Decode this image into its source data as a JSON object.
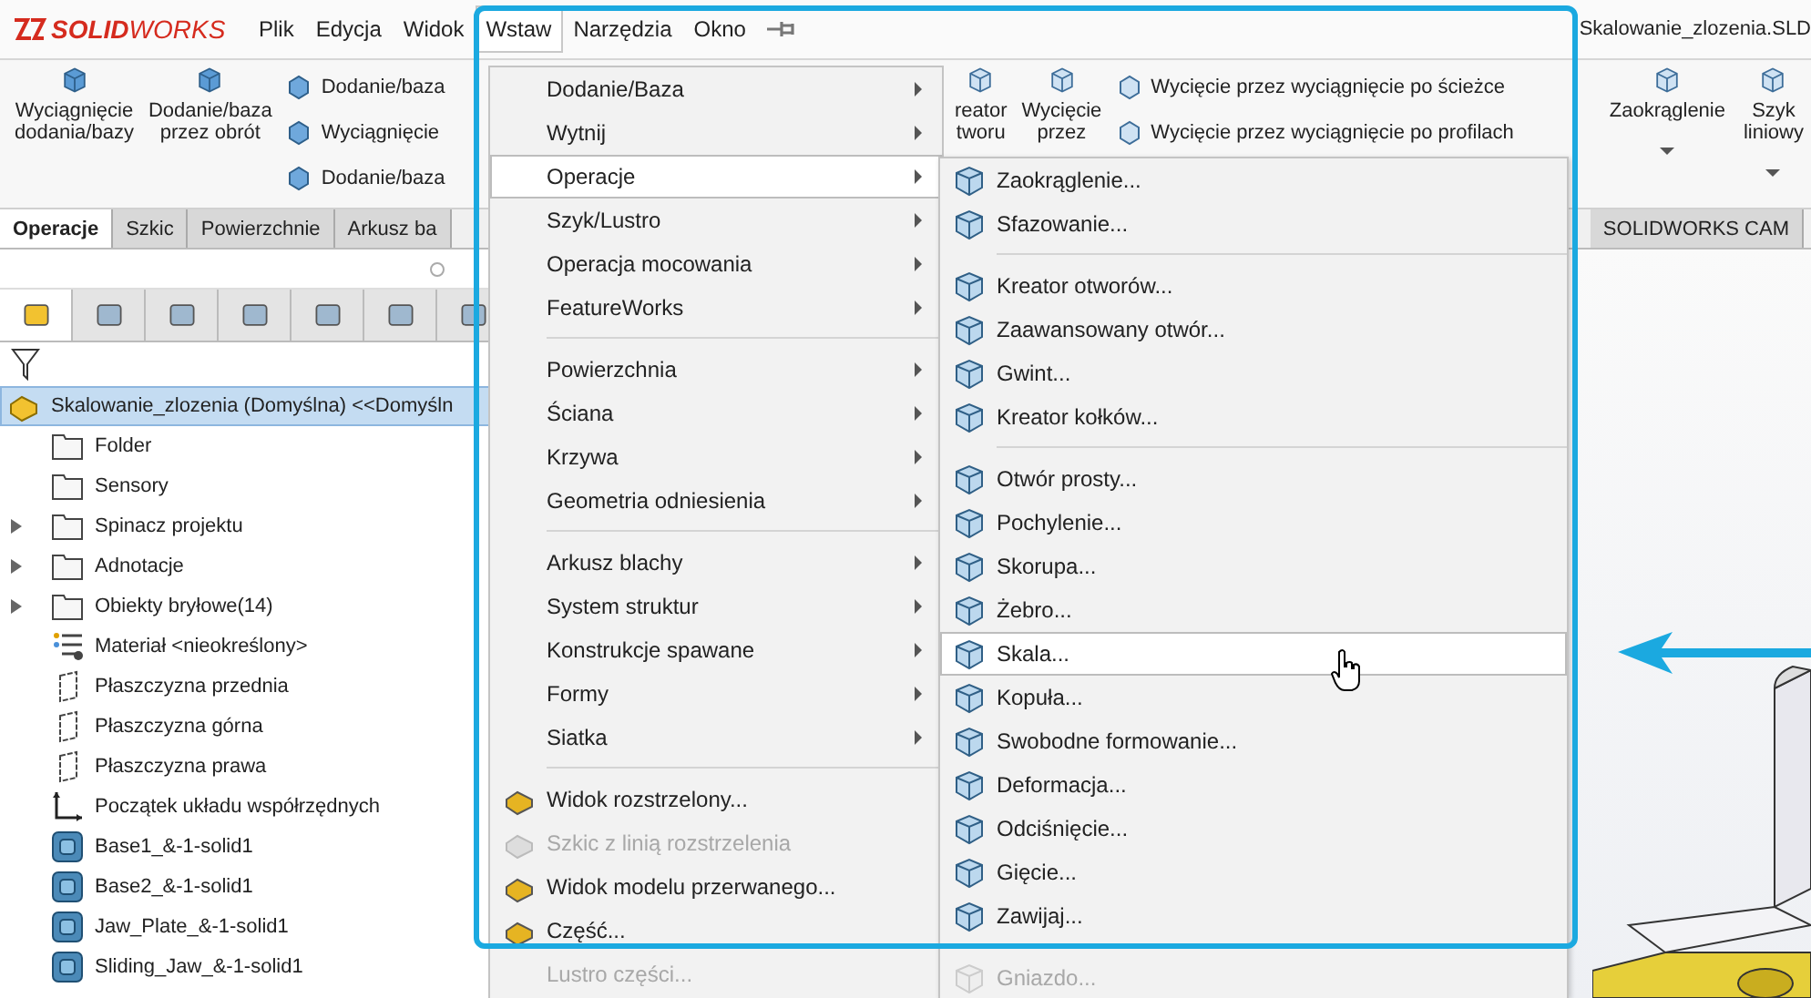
{
  "app": {
    "logo_bold": "SOLID",
    "logo_light": "WORKS",
    "document_title": "Skalowanie_zlozenia.SLD"
  },
  "menu_bar": [
    {
      "label": "Plik",
      "selected": false
    },
    {
      "label": "Edycja",
      "selected": false
    },
    {
      "label": "Widok",
      "selected": false
    },
    {
      "label": "Wstaw",
      "selected": true
    },
    {
      "label": "Narzędzia",
      "selected": false
    },
    {
      "label": "Okno",
      "selected": false
    }
  ],
  "ribbon_left": [
    {
      "kind": "large",
      "lines": [
        "Wyciągnięcie",
        "dodania/bazy"
      ]
    },
    {
      "kind": "large",
      "lines": [
        "Dodanie/baza",
        "przez obrót"
      ]
    },
    {
      "kind": "stack",
      "items": [
        "Dodanie/baza",
        "Wyciągnięcie",
        "Dodanie/baza"
      ]
    }
  ],
  "ribbon_right": [
    {
      "kind": "large",
      "lines": [
        "reator",
        "tworu"
      ]
    },
    {
      "kind": "large",
      "lines": [
        "Wycięcie",
        "przez"
      ]
    },
    {
      "kind": "stack",
      "items": [
        "Wycięcie przez wyciągnięcie po ścieżce",
        "Wycięcie przez wyciągnięcie po profilach"
      ]
    },
    {
      "kind": "caret",
      "lines": [
        "Zaokrąglenie"
      ]
    },
    {
      "kind": "caret",
      "lines": [
        "Szyk",
        "liniowy"
      ]
    }
  ],
  "ribbon_tabs": [
    {
      "label": "Operacje",
      "selected": true
    },
    {
      "label": "Szkic",
      "selected": false
    },
    {
      "label": "Powierzchnie",
      "selected": false
    },
    {
      "label": "Arkusz ba",
      "selected": false
    }
  ],
  "ribbon_tabs_right": [
    {
      "label": "SOLIDWORKS CAM",
      "selected": false
    }
  ],
  "panel_tabs": [
    {
      "selected": true
    },
    {
      "selected": false
    },
    {
      "selected": false
    },
    {
      "selected": false
    },
    {
      "selected": false
    },
    {
      "selected": false
    },
    {
      "selected": false
    }
  ],
  "tree": {
    "root": {
      "label": "Skalowanie_zlozenia (Domyślna) <<Domyśln",
      "selected": true
    },
    "items": [
      {
        "label": "Folder",
        "kind": "folder",
        "expandable": false
      },
      {
        "label": "Sensory",
        "kind": "folder",
        "expandable": false
      },
      {
        "label": "Spinacz projektu",
        "kind": "folder",
        "expandable": true
      },
      {
        "label": "Adnotacje",
        "kind": "folder",
        "expandable": true
      },
      {
        "label": "Obiekty bryłowe(14)",
        "kind": "folder",
        "expandable": true
      },
      {
        "label": "Materiał <nieokreślony>",
        "kind": "material",
        "expandable": false
      },
      {
        "label": "Płaszczyzna przednia",
        "kind": "plane",
        "expandable": false
      },
      {
        "label": "Płaszczyzna górna",
        "kind": "plane",
        "expandable": false
      },
      {
        "label": "Płaszczyzna prawa",
        "kind": "plane",
        "expandable": false
      },
      {
        "label": "Początek układu współrzędnych",
        "kind": "origin",
        "expandable": false
      },
      {
        "label": "Base1_&-1-solid1",
        "kind": "solid",
        "expandable": false
      },
      {
        "label": "Base2_&-1-solid1",
        "kind": "solid",
        "expandable": false
      },
      {
        "label": "Jaw_Plate_&-1-solid1",
        "kind": "solid",
        "expandable": false
      },
      {
        "label": "Sliding_Jaw_&-1-solid1",
        "kind": "solid",
        "expandable": false
      }
    ]
  },
  "insert_menu": {
    "groups": [
      [
        {
          "label": "Dodanie/Baza",
          "kind": "submenu",
          "selected": false,
          "disabled": false
        },
        {
          "label": "Wytnij",
          "kind": "submenu",
          "selected": false,
          "disabled": false
        },
        {
          "label": "Operacje",
          "kind": "submenu",
          "selected": true,
          "disabled": false
        },
        {
          "label": "Szyk/Lustro",
          "kind": "submenu",
          "selected": false,
          "disabled": false
        },
        {
          "label": "Operacja mocowania",
          "kind": "submenu",
          "selected": false,
          "disabled": false
        },
        {
          "label": "FeatureWorks",
          "kind": "submenu",
          "selected": false,
          "disabled": false
        }
      ],
      [
        {
          "label": "Powierzchnia",
          "kind": "submenu",
          "selected": false,
          "disabled": false
        },
        {
          "label": "Ściana",
          "kind": "submenu",
          "selected": false,
          "disabled": false
        },
        {
          "label": "Krzywa",
          "kind": "submenu",
          "selected": false,
          "disabled": false
        },
        {
          "label": "Geometria odniesienia",
          "kind": "submenu",
          "selected": false,
          "disabled": false
        }
      ],
      [
        {
          "label": "Arkusz blachy",
          "kind": "submenu",
          "selected": false,
          "disabled": false
        },
        {
          "label": "System struktur",
          "kind": "submenu",
          "selected": false,
          "disabled": false
        },
        {
          "label": "Konstrukcje spawane",
          "kind": "submenu",
          "selected": false,
          "disabled": false
        },
        {
          "label": "Formy",
          "kind": "submenu",
          "selected": false,
          "disabled": false
        },
        {
          "label": "Siatka",
          "kind": "submenu",
          "selected": false,
          "disabled": false
        }
      ],
      [
        {
          "label": "Widok rozstrzelony...",
          "kind": "command",
          "selected": false,
          "disabled": false
        },
        {
          "label": "Szkic z linią rozstrzelenia",
          "kind": "command",
          "selected": false,
          "disabled": true
        },
        {
          "label": "Widok modelu przerwanego...",
          "kind": "command",
          "selected": false,
          "disabled": false
        },
        {
          "label": "Część...",
          "kind": "command",
          "selected": false,
          "disabled": false
        },
        {
          "label": "Lustro części...",
          "kind": "plain",
          "selected": false,
          "disabled": true
        }
      ]
    ]
  },
  "operations_menu": {
    "groups": [
      [
        {
          "label": "Zaokrąglenie...",
          "selected": false,
          "disabled": false
        },
        {
          "label": "Sfazowanie...",
          "selected": false,
          "disabled": false
        }
      ],
      [
        {
          "label": "Kreator otworów...",
          "selected": false,
          "disabled": false
        },
        {
          "label": "Zaawansowany otwór...",
          "selected": false,
          "disabled": false
        },
        {
          "label": "Gwint...",
          "selected": false,
          "disabled": false
        },
        {
          "label": "Kreator kołków...",
          "selected": false,
          "disabled": false
        }
      ],
      [
        {
          "label": "Otwór prosty...",
          "selected": false,
          "disabled": false
        },
        {
          "label": "Pochylenie...",
          "selected": false,
          "disabled": false
        },
        {
          "label": "Skorupa...",
          "selected": false,
          "disabled": false
        },
        {
          "label": "Żebro...",
          "selected": false,
          "disabled": false
        },
        {
          "label": "Skala...",
          "selected": true,
          "disabled": false
        },
        {
          "label": "Kopuła...",
          "selected": false,
          "disabled": false
        },
        {
          "label": "Swobodne formowanie...",
          "selected": false,
          "disabled": false
        },
        {
          "label": "Deformacja...",
          "selected": false,
          "disabled": false
        },
        {
          "label": "Odciśnięcie...",
          "selected": false,
          "disabled": false
        },
        {
          "label": "Gięcie...",
          "selected": false,
          "disabled": false
        },
        {
          "label": "Zawijaj...",
          "selected": false,
          "disabled": false
        }
      ],
      [
        {
          "label": "Gniazdo...",
          "selected": false,
          "disabled": true
        }
      ]
    ]
  }
}
